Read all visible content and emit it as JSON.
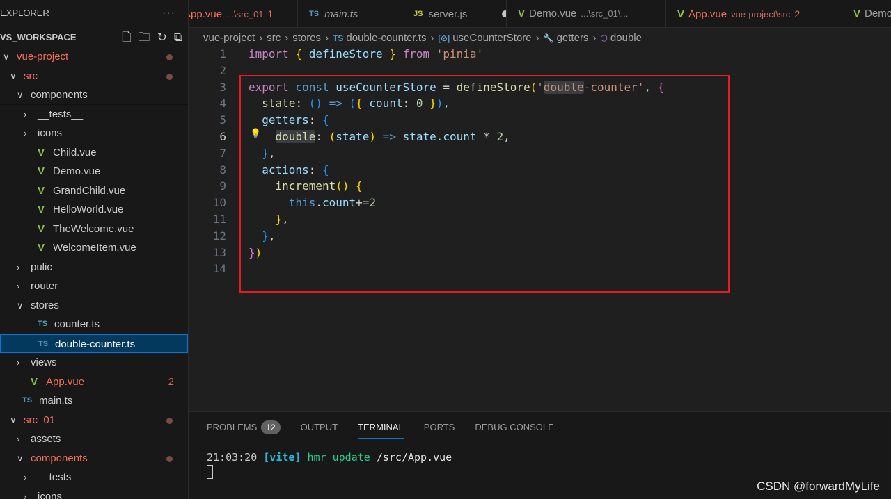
{
  "sidebar": {
    "title": "EXPLORER",
    "more": "···",
    "workspace": "VS_WORKSPACE",
    "items": [
      {
        "label": "vue-project",
        "depth": 0,
        "kind": "folder-open",
        "modified": true,
        "dot": true
      },
      {
        "label": "src",
        "depth": 1,
        "kind": "folder-open",
        "modified": true,
        "dot": true
      },
      {
        "label": "components",
        "depth": 2,
        "kind": "folder-open"
      },
      {
        "label": "__tests__",
        "depth": 3,
        "kind": "folder"
      },
      {
        "label": "icons",
        "depth": 3,
        "kind": "folder"
      },
      {
        "label": "Child.vue",
        "depth": 3,
        "kind": "vue"
      },
      {
        "label": "Demo.vue",
        "depth": 3,
        "kind": "vue"
      },
      {
        "label": "GrandChild.vue",
        "depth": 3,
        "kind": "vue"
      },
      {
        "label": "HelloWorld.vue",
        "depth": 3,
        "kind": "vue"
      },
      {
        "label": "TheWelcome.vue",
        "depth": 3,
        "kind": "vue"
      },
      {
        "label": "WelcomeItem.vue",
        "depth": 3,
        "kind": "vue"
      },
      {
        "label": "pulic",
        "depth": 2,
        "kind": "folder"
      },
      {
        "label": "router",
        "depth": 2,
        "kind": "folder"
      },
      {
        "label": "stores",
        "depth": 2,
        "kind": "folder-open"
      },
      {
        "label": "counter.ts",
        "depth": 3,
        "kind": "ts"
      },
      {
        "label": "double-counter.ts",
        "depth": 3,
        "kind": "ts",
        "selected": true
      },
      {
        "label": "views",
        "depth": 2,
        "kind": "folder"
      },
      {
        "label": "App.vue",
        "depth": 2,
        "kind": "vue",
        "modified": true,
        "count": "2"
      },
      {
        "label": "main.ts",
        "depth": 2,
        "kind": "ts"
      },
      {
        "label": "src_01",
        "depth": 1,
        "kind": "folder-open",
        "modified": true,
        "dot": true
      },
      {
        "label": "assets",
        "depth": 2,
        "kind": "folder"
      },
      {
        "label": "components",
        "depth": 2,
        "kind": "folder-open",
        "modified": true,
        "dot": true
      },
      {
        "label": "__tests__",
        "depth": 3,
        "kind": "folder"
      },
      {
        "label": "icons",
        "depth": 3,
        "kind": "folder"
      }
    ]
  },
  "tabs": [
    {
      "label": "App.vue",
      "desc": "...\\src_01",
      "num": "1",
      "icon": "vue",
      "error": true,
      "clipped": true
    },
    {
      "label": "main.ts",
      "icon": "ts",
      "italic": true
    },
    {
      "label": "server.js",
      "icon": "js",
      "dirty": true
    },
    {
      "label": "Demo.vue",
      "desc": "...\\src_01\\...",
      "icon": "vue"
    },
    {
      "label": "App.vue",
      "desc": "vue-project\\src",
      "num": "2",
      "icon": "vue",
      "error": true
    },
    {
      "label": "Demo.vue",
      "icon": "vue"
    }
  ],
  "breadcrumb": [
    "vue-project",
    "src",
    "stores",
    "double-counter.ts",
    "useCounterStore",
    "getters",
    "double"
  ],
  "editor": {
    "current_line": 6,
    "lines": [
      [
        [
          "import",
          "kw"
        ],
        [
          " ",
          "op"
        ],
        [
          "{",
          "b1"
        ],
        [
          " defineStore ",
          "var"
        ],
        [
          "}",
          "b1"
        ],
        [
          " ",
          "op"
        ],
        [
          "from",
          "kw"
        ],
        [
          " ",
          "op"
        ],
        [
          "'pinia'",
          "str"
        ]
      ],
      [],
      [
        [
          "export",
          "kw"
        ],
        [
          " ",
          "op"
        ],
        [
          "const",
          "st"
        ],
        [
          " useCounterStore",
          "var"
        ],
        [
          " = ",
          "op"
        ],
        [
          "defineStore",
          "fn"
        ],
        [
          "(",
          "b1"
        ],
        [
          "'",
          "str"
        ],
        [
          "double",
          "str-hl"
        ],
        [
          "-counter'",
          "str"
        ],
        [
          ", ",
          "op"
        ],
        [
          "{",
          "b2"
        ]
      ],
      [
        [
          "  state",
          "fn"
        ],
        [
          ": ",
          "op"
        ],
        [
          "()",
          "b3"
        ],
        [
          " => ",
          "st"
        ],
        [
          "(",
          "b3"
        ],
        [
          "{",
          "b1"
        ],
        [
          " count",
          "prop"
        ],
        [
          ": ",
          "op"
        ],
        [
          "0",
          "num"
        ],
        [
          " ",
          "op"
        ],
        [
          "}",
          "b1"
        ],
        [
          ")",
          "b3"
        ],
        [
          ",",
          "op"
        ]
      ],
      [
        [
          "  getters",
          "prop"
        ],
        [
          ": ",
          "op"
        ],
        [
          "{",
          "b3"
        ]
      ],
      [
        [
          "    ",
          "op"
        ],
        [
          "double",
          "fn-hl"
        ],
        [
          ": ",
          "op"
        ],
        [
          "(",
          "b1"
        ],
        [
          "state",
          "var"
        ],
        [
          ")",
          "b1"
        ],
        [
          " => ",
          "st"
        ],
        [
          "state",
          "var"
        ],
        [
          ".",
          "op"
        ],
        [
          "count",
          "prop"
        ],
        [
          " * ",
          "op"
        ],
        [
          "2",
          "num"
        ],
        [
          ",",
          "op"
        ]
      ],
      [
        [
          "  ",
          "op"
        ],
        [
          "}",
          "b3"
        ],
        [
          ",",
          "op"
        ]
      ],
      [
        [
          "  actions",
          "prop"
        ],
        [
          ": ",
          "op"
        ],
        [
          "{",
          "b3"
        ]
      ],
      [
        [
          "    increment",
          "fn"
        ],
        [
          "()",
          "b1"
        ],
        [
          " ",
          "op"
        ],
        [
          "{",
          "b1"
        ]
      ],
      [
        [
          "      ",
          "op"
        ],
        [
          "this",
          "this"
        ],
        [
          ".",
          "op"
        ],
        [
          "count",
          "prop"
        ],
        [
          "+=",
          "op"
        ],
        [
          "2",
          "num"
        ]
      ],
      [
        [
          "    ",
          "op"
        ],
        [
          "}",
          "b1"
        ],
        [
          ",",
          "op"
        ]
      ],
      [
        [
          "  ",
          "op"
        ],
        [
          "}",
          "b3"
        ],
        [
          ",",
          "op"
        ]
      ],
      [
        [
          "}",
          "b2"
        ],
        [
          ")",
          "b1"
        ]
      ],
      []
    ]
  },
  "panel": {
    "tabs": [
      "PROBLEMS",
      "OUTPUT",
      "TERMINAL",
      "PORTS",
      "DEBUG CONSOLE"
    ],
    "problems_count": "12",
    "active": "TERMINAL",
    "terminal": {
      "time": "21:03:20",
      "tag": "[vite]",
      "msg": "hmr update",
      "path": "/src/App.vue"
    }
  },
  "watermark": "CSDN @forwardMyLife",
  "colors": {
    "accent": "#0078d4",
    "modified": "#f0705a",
    "highlight_box": "#e51c23"
  }
}
